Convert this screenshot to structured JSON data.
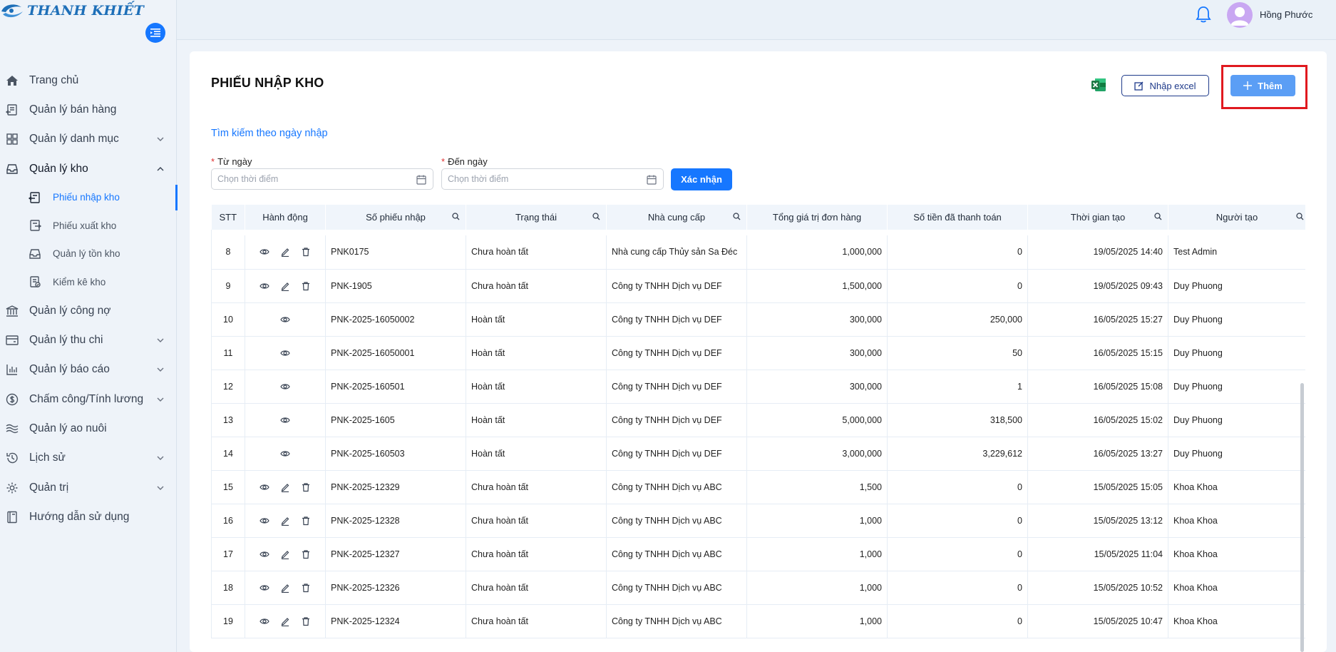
{
  "brand": {
    "name": "THANH KHIẾT"
  },
  "header": {
    "username": "Hồng Phước"
  },
  "sidebar": {
    "items": [
      {
        "label": "Trang chủ",
        "icon": "home-icon",
        "chevron": ""
      },
      {
        "label": "Quản lý bán hàng",
        "icon": "sales-icon",
        "chevron": ""
      },
      {
        "label": "Quản lý danh mục",
        "icon": "grid-icon",
        "chevron": "down"
      },
      {
        "label": "Quản lý kho",
        "icon": "inbox-icon",
        "chevron": "up"
      },
      {
        "label": "Quản lý công nợ",
        "icon": "bank-icon",
        "chevron": ""
      },
      {
        "label": "Quản lý thu chi",
        "icon": "wallet-icon",
        "chevron": "down"
      },
      {
        "label": "Quản lý báo cáo",
        "icon": "bar-chart-icon",
        "chevron": "down"
      },
      {
        "label": "Chấm công/Tính lương",
        "icon": "dollar-icon",
        "chevron": "down"
      },
      {
        "label": "Quản lý ao nuôi",
        "icon": "water-icon",
        "chevron": ""
      },
      {
        "label": "Lịch sử",
        "icon": "history-icon",
        "chevron": "down"
      },
      {
        "label": "Quản trị",
        "icon": "gear-icon",
        "chevron": "down"
      },
      {
        "label": "Hướng dẫn sử dụng",
        "icon": "book-icon",
        "chevron": ""
      }
    ],
    "sub_items": [
      {
        "label": "Phiếu nhập kho",
        "icon": "import-icon",
        "active": true
      },
      {
        "label": "Phiếu xuất kho",
        "icon": "export-icon",
        "active": false
      },
      {
        "label": "Quản lý tồn kho",
        "icon": "inbox-icon",
        "active": false
      },
      {
        "label": "Kiểm kê kho",
        "icon": "checklist-icon",
        "active": false
      }
    ]
  },
  "main": {
    "title": "PHIẾU NHẬP KHO",
    "import_label": "Nhập excel",
    "add_label": "Thêm",
    "search_title": "Tìm kiếm theo ngày nhập",
    "from_label": "Từ ngày",
    "to_label": "Đến ngày",
    "from_placeholder": "Chọn thời điểm",
    "to_placeholder": "Chọn thời điểm",
    "confirm_label": "Xác nhận"
  },
  "table": {
    "columns": [
      "STT",
      "Hành động",
      "Số phiếu nhập",
      "Trạng thái",
      "Nhà cung cấp",
      "Tổng giá trị đơn hàng",
      "Số tiền đã thanh toán",
      "Thời gian tạo",
      "Người tạo"
    ],
    "rows": [
      {
        "stt": "8",
        "actions": "view-edit-delete",
        "code": "PNK0175",
        "status": "Chưa hoàn tất",
        "supplier": "Nhà cung cấp Thủy sản Sa Đéc",
        "total": "1,000,000",
        "paid": "0",
        "created": "19/05/2025 14:40",
        "creator": "Test Admin"
      },
      {
        "stt": "9",
        "actions": "view-edit-delete",
        "code": "PNK-1905",
        "status": "Chưa hoàn tất",
        "supplier": "Công ty TNHH Dịch vụ DEF",
        "total": "1,500,000",
        "paid": "0",
        "created": "19/05/2025 09:43",
        "creator": "Duy Phuong"
      },
      {
        "stt": "10",
        "actions": "view",
        "code": "PNK-2025-16050002",
        "status": "Hoàn tất",
        "supplier": "Công ty TNHH Dịch vụ DEF",
        "total": "300,000",
        "paid": "250,000",
        "created": "16/05/2025 15:27",
        "creator": "Duy Phuong"
      },
      {
        "stt": "11",
        "actions": "view",
        "code": "PNK-2025-16050001",
        "status": "Hoàn tất",
        "supplier": "Công ty TNHH Dịch vụ DEF",
        "total": "300,000",
        "paid": "50",
        "created": "16/05/2025 15:15",
        "creator": "Duy Phuong"
      },
      {
        "stt": "12",
        "actions": "view",
        "code": "PNK-2025-160501",
        "status": "Hoàn tất",
        "supplier": "Công ty TNHH Dịch vụ DEF",
        "total": "300,000",
        "paid": "1",
        "created": "16/05/2025 15:08",
        "creator": "Duy Phuong"
      },
      {
        "stt": "13",
        "actions": "view",
        "code": "PNK-2025-1605",
        "status": "Hoàn tất",
        "supplier": "Công ty TNHH Dịch vụ DEF",
        "total": "5,000,000",
        "paid": "318,500",
        "created": "16/05/2025 15:02",
        "creator": "Duy Phuong"
      },
      {
        "stt": "14",
        "actions": "view",
        "code": "PNK-2025-160503",
        "status": "Hoàn tất",
        "supplier": "Công ty TNHH Dịch vụ DEF",
        "total": "3,000,000",
        "paid": "3,229,612",
        "created": "16/05/2025 13:27",
        "creator": "Duy Phuong"
      },
      {
        "stt": "15",
        "actions": "view-edit-delete",
        "code": "PNK-2025-12329",
        "status": "Chưa hoàn tất",
        "supplier": "Công ty TNHH Dịch vụ ABC",
        "total": "1,500",
        "paid": "0",
        "created": "15/05/2025 15:05",
        "creator": "Khoa Khoa"
      },
      {
        "stt": "16",
        "actions": "view-edit-delete",
        "code": "PNK-2025-12328",
        "status": "Chưa hoàn tất",
        "supplier": "Công ty TNHH Dịch vụ ABC",
        "total": "1,000",
        "paid": "0",
        "created": "15/05/2025 13:12",
        "creator": "Khoa Khoa"
      },
      {
        "stt": "17",
        "actions": "view-edit-delete",
        "code": "PNK-2025-12327",
        "status": "Chưa hoàn tất",
        "supplier": "Công ty TNHH Dịch vụ ABC",
        "total": "1,000",
        "paid": "0",
        "created": "15/05/2025 11:04",
        "creator": "Khoa Khoa"
      },
      {
        "stt": "18",
        "actions": "view-edit-delete",
        "code": "PNK-2025-12326",
        "status": "Chưa hoàn tất",
        "supplier": "Công ty TNHH Dịch vụ ABC",
        "total": "1,000",
        "paid": "0",
        "created": "15/05/2025 10:52",
        "creator": "Khoa Khoa"
      },
      {
        "stt": "19",
        "actions": "view-edit-delete",
        "code": "PNK-2025-12324",
        "status": "Chưa hoàn tất",
        "supplier": "Công ty TNHH Dịch vụ ABC",
        "total": "1,000",
        "paid": "0",
        "created": "15/05/2025 10:47",
        "creator": "Khoa Khoa"
      }
    ]
  },
  "colors": {
    "primary": "#1677ff",
    "highlight": "#e0191f",
    "excel": "#1f7a45"
  }
}
